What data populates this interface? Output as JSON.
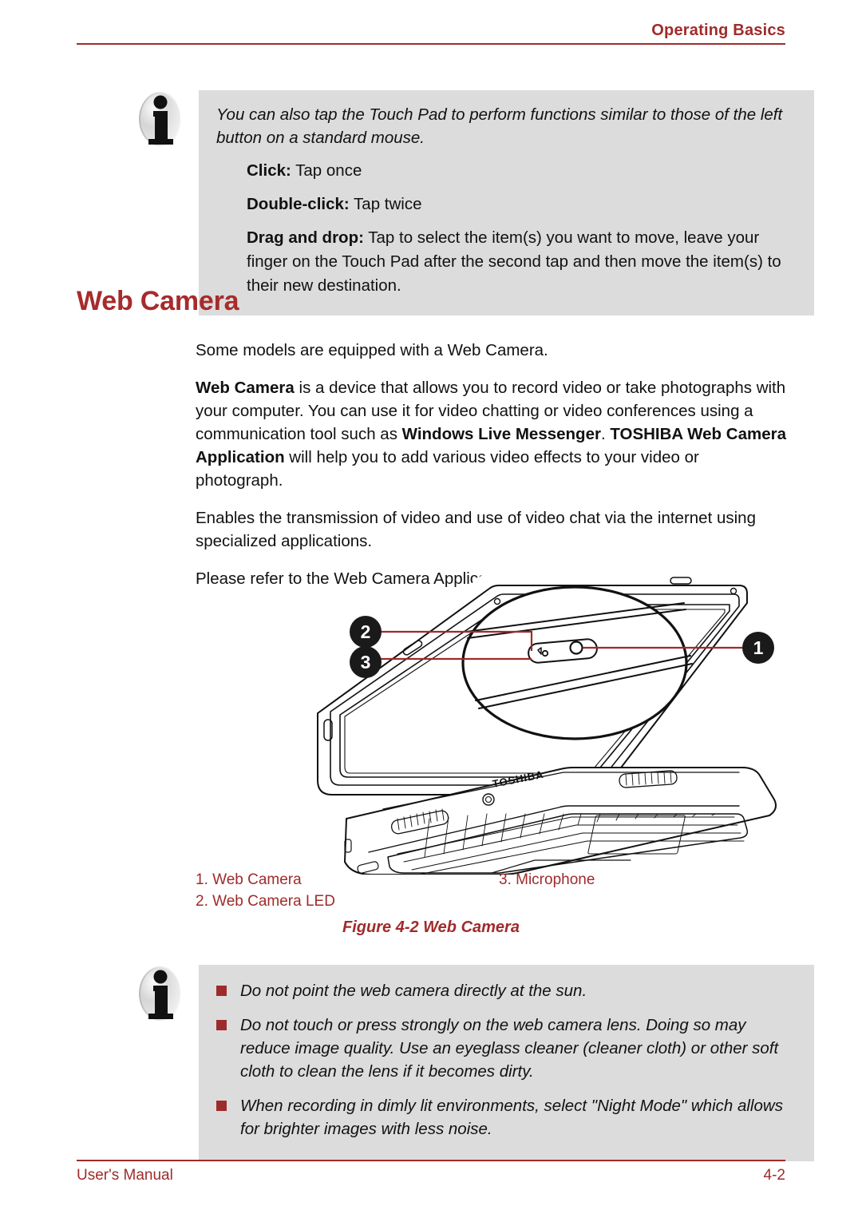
{
  "header": {
    "title": "Operating Basics",
    "rule_color": "#A02B2B"
  },
  "info_box_top": {
    "icon": "info-icon",
    "intro": "You can also tap the Touch Pad to perform functions similar to those of the left button on a standard mouse.",
    "items": [
      {
        "term": "Click:",
        "desc": " Tap once"
      },
      {
        "term": "Double-click:",
        "desc": " Tap twice"
      },
      {
        "term": "Drag and drop:",
        "desc": " Tap to select the item(s) you want to move, leave your finger on the Touch Pad after the second tap and then move the item(s) to their new destination."
      }
    ]
  },
  "section": {
    "heading": "Web Camera",
    "paragraphs": [
      {
        "text": "Some models are equipped with a Web Camera."
      },
      {
        "html": "<b>Web Camera</b> is a device that allows you to record video or take photographs with your computer. You can use it for video chatting or video conferences using a communication tool such as <b>Windows Live Messenger</b>. <b>TOSHIBA Web Camera Application</b> will help you to add various video effects to your video or photograph."
      },
      {
        "text": "Enables the transmission of video and use of video chat via the internet using specialized applications."
      },
      {
        "text": "Please refer to the Web Camera Application Online Help for details."
      }
    ]
  },
  "figure": {
    "callouts": [
      {
        "number": "1"
      },
      {
        "number": "2"
      },
      {
        "number": "3"
      }
    ],
    "brand_logo": "TOSHIBA",
    "legend": [
      {
        "label": "1. Web Camera"
      },
      {
        "label": "2. Web Camera LED"
      },
      {
        "label": "3. Microphone"
      }
    ],
    "caption": "Figure 4-2 Web Camera",
    "caption_color": "#A02B2B"
  },
  "info_box_bottom": {
    "icon": "info-icon",
    "bullets": [
      "Do not point the web camera directly at the sun.",
      "Do not touch or press strongly on the web camera lens. Doing so may reduce image quality. Use an eyeglass cleaner (cleaner cloth) or other soft cloth to clean the lens if it becomes dirty.",
      "When recording in dimly lit environments, select \"Night Mode\" which allows for brighter images with less noise."
    ],
    "bullet_color": "#9E2B2B",
    "background": "#DCDCDC"
  },
  "footer": {
    "left": "User's Manual",
    "right": "4-2",
    "rule_color": "#A02B2B"
  }
}
